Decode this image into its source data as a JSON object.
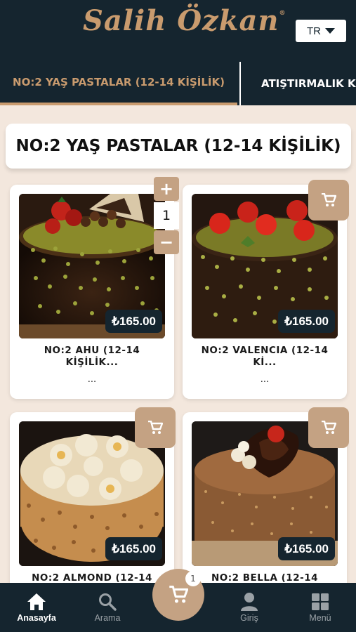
{
  "header": {
    "logo_text": "Salih Özkan",
    "logo_mark": "®",
    "language": "TR"
  },
  "tabs": [
    {
      "label": "NO:2 YAŞ PASTALAR (12-14 KİŞİLİK)",
      "active": true
    },
    {
      "label": "ATIŞTIRMALIK KA"
    }
  ],
  "section_title": "NO:2 YAŞ PASTALAR (12-14 KİŞİLİK)",
  "products": [
    {
      "name": "NO:2 AHU (12-14 KİŞİLİK...",
      "description": "...",
      "price": "₺165.00",
      "quantity": "1"
    },
    {
      "name": "NO:2 VALENCIA (12-14 Kİ...",
      "description": "...",
      "price": "₺165.00"
    },
    {
      "name": "NO:2 ALMOND (12-14",
      "description": "",
      "price": "₺165.00"
    },
    {
      "name": "NO:2 BELLA (12-14",
      "description": "",
      "price": "₺165.00"
    }
  ],
  "cart": {
    "count": "1",
    "icon": "cart-icon"
  },
  "bottom_nav": [
    {
      "label": "Anasayfa",
      "icon": "home-icon",
      "active": true
    },
    {
      "label": "Arama",
      "icon": "search-icon"
    },
    {
      "label": "Giriş",
      "icon": "user-icon"
    },
    {
      "label": "Menü",
      "icon": "grid-menu-icon"
    }
  ],
  "colors": {
    "header_bg": "#15252f",
    "accent": "#c99b6e",
    "button_tan": "#c4a283",
    "page_bg": "#f3e7dd"
  }
}
